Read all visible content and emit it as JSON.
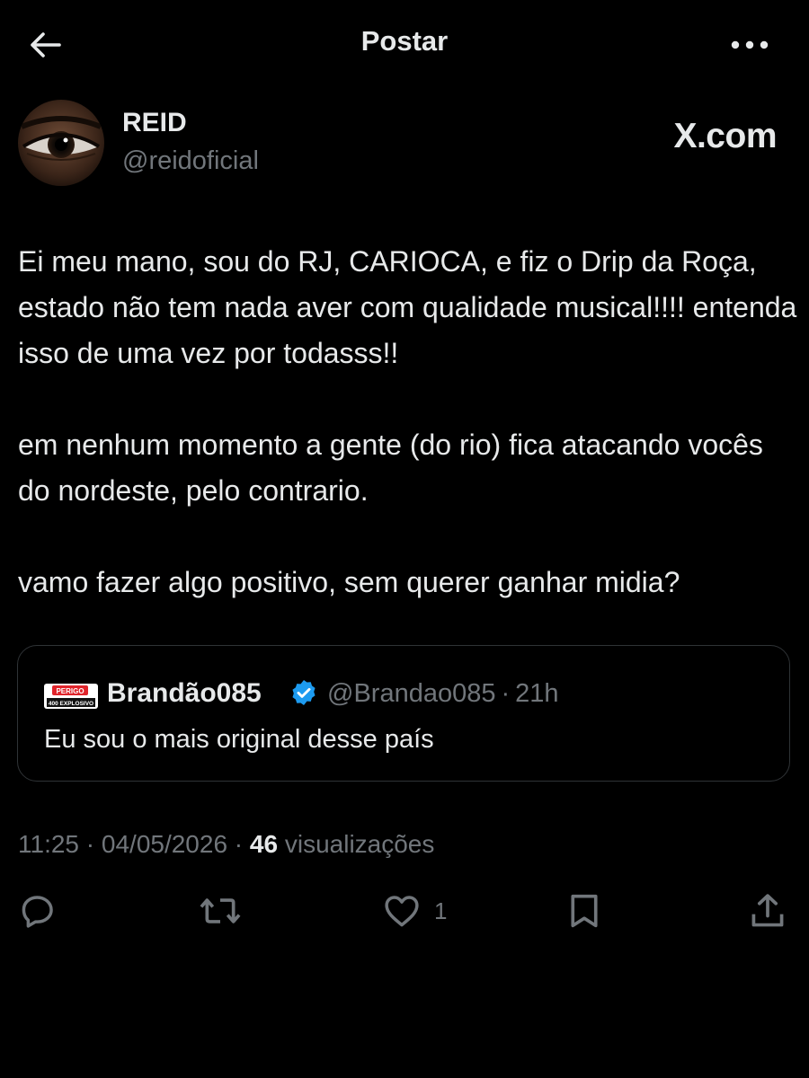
{
  "header": {
    "title": "Postar",
    "back_icon": "arrow-left-icon",
    "more_icon": "more-horizontal-icon"
  },
  "post": {
    "author": {
      "name": "REID",
      "handle": "@reidoficial",
      "avatar": "avatar-eye-image"
    },
    "brand": "X.com",
    "body": "Ei meu mano, sou do RJ, CARIOCA, e fiz o Drip da Roça, estado não tem nada aver com qualidade musical!!!! entenda isso de uma vez por todasss!!\n\nem nenhum momento a gente (do rio) fica atacando vocês do nordeste, pelo contrario.\n\nvamo fazer algo positivo, sem querer ganhar midia?",
    "quoted": {
      "name": "Brandão085",
      "verified": true,
      "handle": "@Brandao085",
      "time": "21h",
      "text": "Eu sou o mais original desse país",
      "avatar_badge_top": "PERIGO",
      "avatar_badge_bottom": "400 EXPLOSIVO"
    },
    "time": "11:25",
    "date": "04/05/2026",
    "views_count": "46",
    "views_label": "visualizações"
  },
  "actions": {
    "reply_icon": "reply-icon",
    "repost_icon": "repost-icon",
    "like_icon": "heart-icon",
    "like_count": "1",
    "bookmark_icon": "bookmark-icon",
    "share_icon": "share-icon"
  },
  "colors": {
    "background": "#000000",
    "text_primary": "#e7e9ea",
    "text_secondary": "#71767b",
    "border": "#2f3336",
    "verified_blue": "#1d9bf0",
    "badge_red": "#e0242b"
  }
}
